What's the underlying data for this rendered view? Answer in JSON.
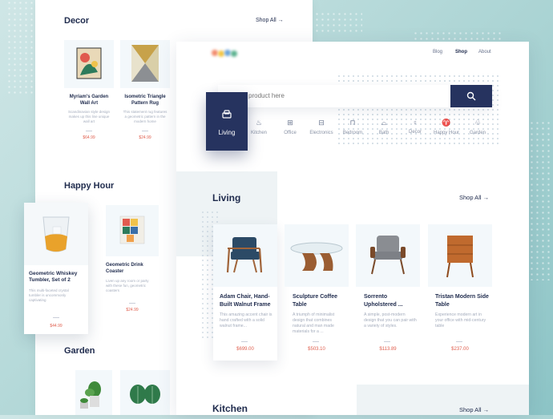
{
  "back_page": {
    "decor": {
      "title": "Decor",
      "shop_all": "Shop All",
      "items": [
        {
          "name": "Myriam's Garden Wall Art",
          "desc": "Scandinavian style design makes up this line unique wall art",
          "price": "$64.99"
        },
        {
          "name": "Isometric Triangle Pattern Rug",
          "desc": "This statement rug features a geometric pattern in the modern home",
          "price": "$24.99"
        }
      ]
    },
    "happy_hour": {
      "title": "Happy Hour",
      "items": [
        {
          "name": "Geometric Whiskey Tumbler, Set of 2",
          "desc": "This multi-faceted crystal tumbler is uncommonly captivating",
          "price": "$44.99"
        },
        {
          "name": "Geometric Drink Coaster",
          "desc": "Liven up any room or party with these fun, geometric coasters",
          "price": "$24.99"
        }
      ]
    },
    "garden": {
      "title": "Garden"
    }
  },
  "front_page": {
    "nav": [
      "Blog",
      "Shop",
      "About"
    ],
    "active_nav": "Shop",
    "search": {
      "placeholder": "product here"
    },
    "categories": [
      {
        "label": "Living",
        "icon": "armchair-icon",
        "active": true
      },
      {
        "label": "Kitchen",
        "icon": "pot-icon"
      },
      {
        "label": "Office",
        "icon": "desk-icon"
      },
      {
        "label": "Electronics",
        "icon": "radio-icon"
      },
      {
        "label": "Bedroom",
        "icon": "bed-icon"
      },
      {
        "label": "Bath",
        "icon": "bathtub-icon"
      },
      {
        "label": "Decor",
        "icon": "lamp-icon"
      },
      {
        "label": "Happy Hour",
        "icon": "glass-icon"
      },
      {
        "label": "Garden",
        "icon": "plant-icon"
      }
    ],
    "living": {
      "title": "Living",
      "shop_all": "Shop All",
      "products": [
        {
          "name": "Adam Chair, Hand-Built Walnut Frame",
          "desc": "This amazing accent chair is hand crafted with a solid walnut frame...",
          "price": "$699.00"
        },
        {
          "name": "Sculpture Coffee Table",
          "desc": "A triumph of minimalist design that combines natural and man made materials for a ...",
          "price": "$503.10"
        },
        {
          "name": "Sorrento Upholstered ...",
          "desc": "A simple, post-modern design that you can pair with a variety of styles.",
          "price": "$113.89"
        },
        {
          "name": "Tristan Modern Side Table",
          "desc": "Experience modern art in your office with mid-century table",
          "price": "$237.00"
        }
      ]
    },
    "kitchen": {
      "title": "Kitchen",
      "shop_all": "Shop All"
    }
  },
  "colors": {
    "navy": "#26335f",
    "accent_price": "#e0604f",
    "teal_bg": "#a9d3d3"
  }
}
